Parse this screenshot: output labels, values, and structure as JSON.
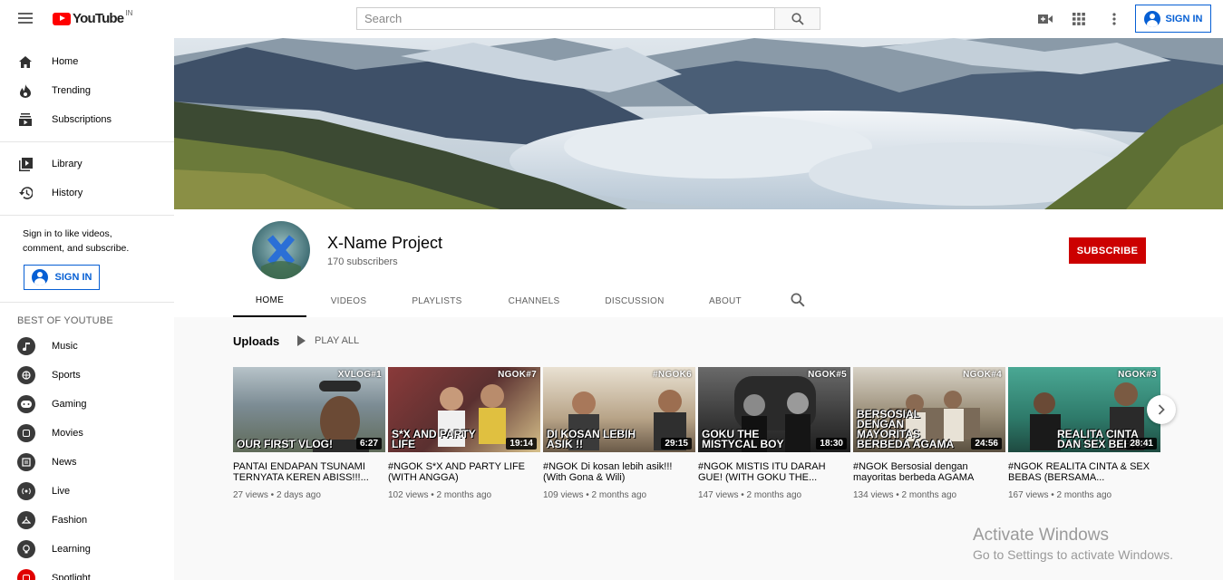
{
  "app": {
    "logo_text": "YouTube",
    "region": "IN"
  },
  "search": {
    "placeholder": "Search"
  },
  "top": {
    "signin_label": "SIGN IN"
  },
  "sidebar": {
    "main": [
      {
        "label": "Home",
        "icon": "home-icon"
      },
      {
        "label": "Trending",
        "icon": "trending-icon"
      },
      {
        "label": "Subscriptions",
        "icon": "subscriptions-icon"
      }
    ],
    "library": [
      {
        "label": "Library",
        "icon": "library-icon"
      },
      {
        "label": "History",
        "icon": "history-icon"
      }
    ],
    "signin_text": "Sign in to like videos, comment, and subscribe.",
    "signin_label": "SIGN IN",
    "best_title": "BEST OF YOUTUBE",
    "best": [
      {
        "label": "Music",
        "icon": "music-icon"
      },
      {
        "label": "Sports",
        "icon": "sports-icon"
      },
      {
        "label": "Gaming",
        "icon": "gaming-icon"
      },
      {
        "label": "Movies",
        "icon": "movies-icon"
      },
      {
        "label": "News",
        "icon": "news-icon"
      },
      {
        "label": "Live",
        "icon": "live-icon"
      },
      {
        "label": "Fashion",
        "icon": "fashion-icon"
      },
      {
        "label": "Learning",
        "icon": "learning-icon"
      },
      {
        "label": "Spotlight",
        "icon": "spotlight-icon"
      }
    ]
  },
  "channel": {
    "name": "X-Name Project",
    "subscribers": "170 subscribers",
    "subscribe_label": "SUBSCRIBE",
    "tabs": [
      "HOME",
      "VIDEOS",
      "PLAYLISTS",
      "CHANNELS",
      "DISCUSSION",
      "ABOUT"
    ]
  },
  "uploads": {
    "title": "Uploads",
    "play_all": "PLAY ALL",
    "videos": [
      {
        "tag": "XVLOG#1",
        "caption": "OUR FIRST VLOG!",
        "duration": "6:27",
        "title": "PANTAI ENDAPAN TSUNAMI TERNYATA KEREN ABISS!!!...",
        "meta": "27 views • 2 days ago",
        "bg": "#7c8c94"
      },
      {
        "tag": "NGOK#7",
        "caption": "S*X AND PARTY LIFE",
        "duration": "19:14",
        "title": "#NGOK S*X AND PARTY LIFE (WITH ANGGA)",
        "meta": "102 views • 2 months ago",
        "bg": "#6e4a4a"
      },
      {
        "tag": "#NGOK6",
        "caption": "DI KOSAN LEBIH ASIK !!",
        "duration": "29:15",
        "title": "#NGOK Di kosan lebih asik!!! (With Gona & Wili)",
        "meta": "109 views • 2 months ago",
        "bg": "#a89678"
      },
      {
        "tag": "NGOK#5",
        "caption": "GOKU THE MISTYCAL BOY",
        "duration": "18:30",
        "title": "#NGOK MISTIS ITU DARAH GUE! (WITH GOKU THE...",
        "meta": "147 views • 2 months ago",
        "bg": "#4a4a4a"
      },
      {
        "tag": "NGOK#4",
        "caption": "BERSOSIAL DENGAN MAYORITAS BERBEDA AGAMA",
        "duration": "24:56",
        "title": "#NGOK Bersosial dengan mayoritas berbeda AGAMA",
        "meta": "134 views • 2 months ago",
        "bg": "#8a8070"
      },
      {
        "tag": "NGOK#3",
        "caption": "REALITA CINTA DAN SEX BEBAS",
        "duration": "28:41",
        "title": "#NGOK REALITA CINTA & SEX BEBAS (BERSAMA...",
        "meta": "167 views • 2 months ago",
        "bg": "#3d8a7a"
      }
    ]
  },
  "watermark": {
    "line1": "Activate Windows",
    "line2": "Go to Settings to activate Windows."
  },
  "colors": {
    "brand_red": "#ff0000",
    "subscribe_red": "#cc0000",
    "link_blue": "#065fd4"
  }
}
